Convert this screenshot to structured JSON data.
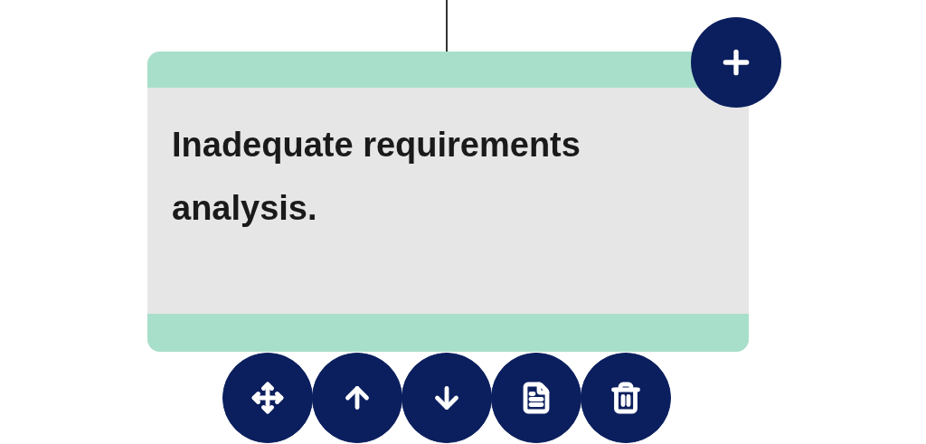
{
  "node": {
    "text": "Inadequate requirements analysis."
  },
  "add_button": {
    "kind": "add"
  },
  "actions": [
    {
      "kind": "move"
    },
    {
      "kind": "up"
    },
    {
      "kind": "down"
    },
    {
      "kind": "details"
    },
    {
      "kind": "delete"
    }
  ]
}
